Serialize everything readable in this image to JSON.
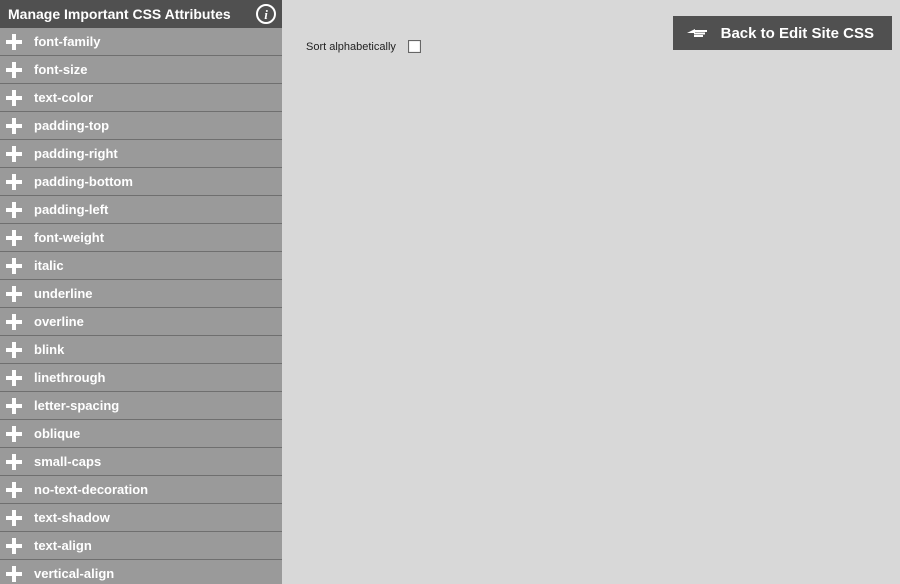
{
  "sidebar": {
    "title": "Manage Important CSS Attributes",
    "items": [
      {
        "label": "font-family"
      },
      {
        "label": "font-size"
      },
      {
        "label": "text-color"
      },
      {
        "label": "padding-top"
      },
      {
        "label": "padding-right"
      },
      {
        "label": "padding-bottom"
      },
      {
        "label": "padding-left"
      },
      {
        "label": "font-weight"
      },
      {
        "label": "italic"
      },
      {
        "label": "underline"
      },
      {
        "label": "overline"
      },
      {
        "label": "blink"
      },
      {
        "label": "linethrough"
      },
      {
        "label": "letter-spacing"
      },
      {
        "label": "oblique"
      },
      {
        "label": "small-caps"
      },
      {
        "label": "no-text-decoration"
      },
      {
        "label": "text-shadow"
      },
      {
        "label": "text-align"
      },
      {
        "label": "vertical-align"
      }
    ]
  },
  "main": {
    "sort_label": "Sort alphabetically",
    "sort_checked": false,
    "back_label": "Back to Edit Site CSS"
  }
}
